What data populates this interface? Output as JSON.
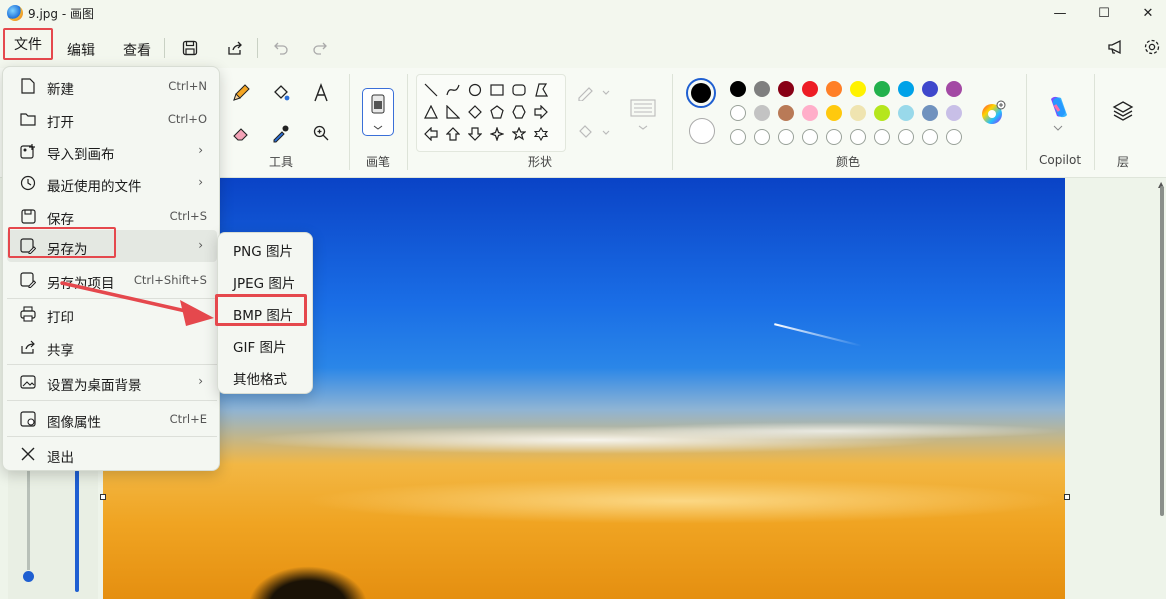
{
  "window": {
    "title": "9.jpg - 画图",
    "controls": {
      "minimize": "—",
      "maximize": "☐",
      "close": "✕"
    }
  },
  "menubar": {
    "file": "文件",
    "edit": "编辑",
    "view": "查看"
  },
  "ribbon": {
    "groups": {
      "tools": "工具",
      "brushes": "画笔",
      "shapes": "形状",
      "colors": "颜色",
      "copilot": "Copilot",
      "layers": "层"
    },
    "palette_row1": [
      "#000000",
      "#7f7f7f",
      "#880015",
      "#ed1c24",
      "#ff7f27",
      "#fff200",
      "#22b14c",
      "#00a2e8",
      "#3f48cc",
      "#a349a4"
    ],
    "palette_row2": [
      "#ffffff",
      "#c3c3c3",
      "#b97a57",
      "#ffaec9",
      "#ffc90e",
      "#efe4b0",
      "#b5e61d",
      "#99d9ea",
      "#7092be",
      "#c8bfe7"
    ],
    "primary_color": "#000000",
    "secondary_color": "#ffffff"
  },
  "file_menu": {
    "items": [
      {
        "label": "新建",
        "shortcut": "Ctrl+N"
      },
      {
        "label": "打开",
        "shortcut": "Ctrl+O"
      },
      {
        "label": "导入到画布",
        "submenu": "›"
      },
      {
        "label": "最近使用的文件",
        "submenu": "›"
      },
      {
        "label": "保存",
        "shortcut": "Ctrl+S"
      },
      {
        "label": "另存为",
        "submenu": "›"
      },
      {
        "label": "另存为项目",
        "shortcut": "Ctrl+Shift+S"
      },
      {
        "label": "打印"
      },
      {
        "label": "共享"
      },
      {
        "label": "设置为桌面背景",
        "submenu": "›"
      },
      {
        "label": "图像属性",
        "shortcut": "Ctrl+E"
      },
      {
        "label": "退出"
      }
    ]
  },
  "save_as_menu": {
    "items": [
      "PNG 图片",
      "JPEG 图片",
      "BMP 图片",
      "GIF 图片",
      "其他格式"
    ]
  }
}
